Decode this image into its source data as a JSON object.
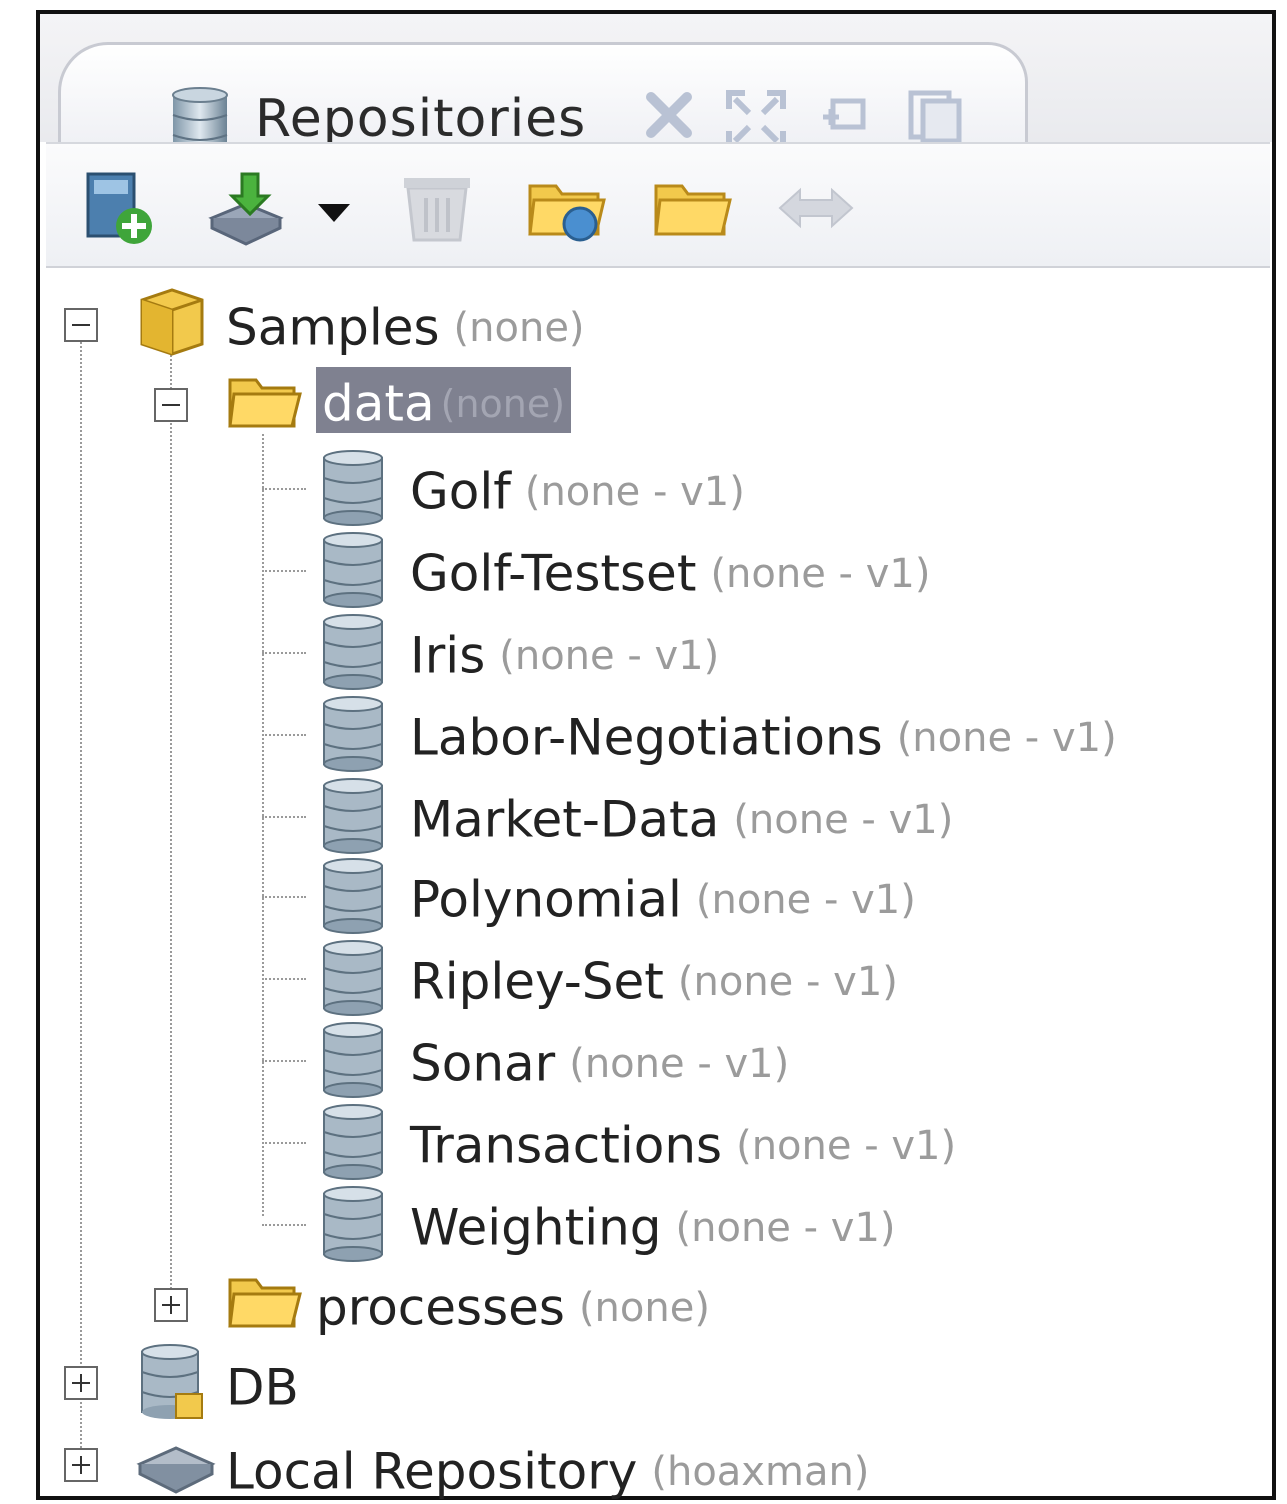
{
  "panel": {
    "tab_title": "Repositories",
    "tab_controls": [
      "close-icon",
      "maximize-icon",
      "restore-icon",
      "detach-icon"
    ]
  },
  "toolbar": {
    "buttons": [
      "add-repository-icon",
      "import-icon",
      "dropdown-icon",
      "delete-icon",
      "open-folder-icon",
      "folder-icon",
      "sync-icon"
    ]
  },
  "tree": {
    "samples": {
      "label": "Samples",
      "meta": "(none)"
    },
    "data_folder": {
      "label": "data",
      "meta": "(none)"
    },
    "datasets": [
      {
        "label": "Golf",
        "meta": "(none - v1)"
      },
      {
        "label": "Golf-Testset",
        "meta": "(none - v1)"
      },
      {
        "label": "Iris",
        "meta": "(none - v1)"
      },
      {
        "label": "Labor-Negotiations",
        "meta": "(none - v1)"
      },
      {
        "label": "Market-Data",
        "meta": "(none - v1)"
      },
      {
        "label": "Polynomial",
        "meta": "(none - v1)"
      },
      {
        "label": "Ripley-Set",
        "meta": "(none - v1)"
      },
      {
        "label": "Sonar",
        "meta": "(none - v1)"
      },
      {
        "label": "Transactions",
        "meta": "(none - v1)"
      },
      {
        "label": "Weighting",
        "meta": "(none - v1)"
      }
    ],
    "processes_folder": {
      "label": "processes",
      "meta": "(none)"
    },
    "db": {
      "label": "DB"
    },
    "local_repository": {
      "label": "Local Repository",
      "meta": "(hoaxman)"
    }
  },
  "colors": {
    "selection": "#7f8190",
    "meta_text": "#9b9b9b",
    "folder": "#f2c94c"
  }
}
